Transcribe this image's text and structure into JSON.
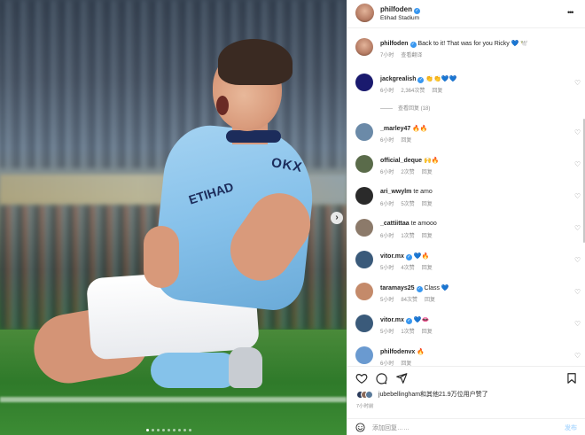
{
  "photo": {
    "sponsor_chest": "OKX",
    "sponsor_sleeve": "ETIHAD",
    "carousel_dots": 9,
    "active_dot": 0
  },
  "header": {
    "username": "philfoden",
    "location": "Etihad Stadium"
  },
  "caption": {
    "username": "philfoden",
    "text": "Back to it! That was for you Ricky 💙 🕊️",
    "time": "7小时",
    "translate": "查看翻译"
  },
  "comments": [
    {
      "username": "jackgrealish",
      "verified": true,
      "text": "👏👏💙💙",
      "time": "6小时",
      "likes": "2,364次赞",
      "reply": "回复",
      "avatar_color": "#1a1a6e"
    },
    {
      "username": "_marley47",
      "verified": false,
      "text": "🔥🔥",
      "time": "6小时",
      "likes": "",
      "reply": "回复",
      "avatar_color": "#6b8aa8"
    },
    {
      "username": "official_deque",
      "verified": false,
      "text": "🙌🔥",
      "time": "6小时",
      "likes": "2次赞",
      "reply": "回复",
      "avatar_color": "#5a6b4a"
    },
    {
      "username": "ari_wwylm",
      "verified": false,
      "text": "te amo",
      "time": "6小时",
      "likes": "5次赞",
      "reply": "回复",
      "avatar_color": "#2a2a2a"
    },
    {
      "username": "_cattiittaa",
      "verified": false,
      "text": "te amooo",
      "time": "6小时",
      "likes": "1次赞",
      "reply": "回复",
      "avatar_color": "#8c7a6a"
    },
    {
      "username": "vitor.mx",
      "verified": true,
      "text": "💙🔥",
      "time": "5小时",
      "likes": "4次赞",
      "reply": "回复",
      "avatar_color": "#3a5a7a"
    },
    {
      "username": "taramays25",
      "verified": true,
      "text": "Class 💙",
      "time": "5小时",
      "likes": "84次赞",
      "reply": "回复",
      "avatar_color": "#c48a6a"
    },
    {
      "username": "vitor.mx",
      "verified": true,
      "text": "💙👄",
      "time": "5小时",
      "likes": "1次赞",
      "reply": "回复",
      "avatar_color": "#3a5a7a"
    },
    {
      "username": "philfodenvx",
      "verified": false,
      "text": "🔥",
      "time": "6小时",
      "likes": "",
      "reply": "回复",
      "avatar_color": "#6a9ad0"
    }
  ],
  "view_replies": "查看回复 (18)",
  "actions": {
    "likers_text": "jubebellingham和其他21.9万位用户赞了",
    "post_time": "7小时前",
    "comment_placeholder": "添加回复……",
    "post_label": "发布"
  },
  "colors": {
    "accent": "#3897f0",
    "muted": "#8e8e8e",
    "border": "#efefef",
    "city_blue": "#86c1ea"
  }
}
